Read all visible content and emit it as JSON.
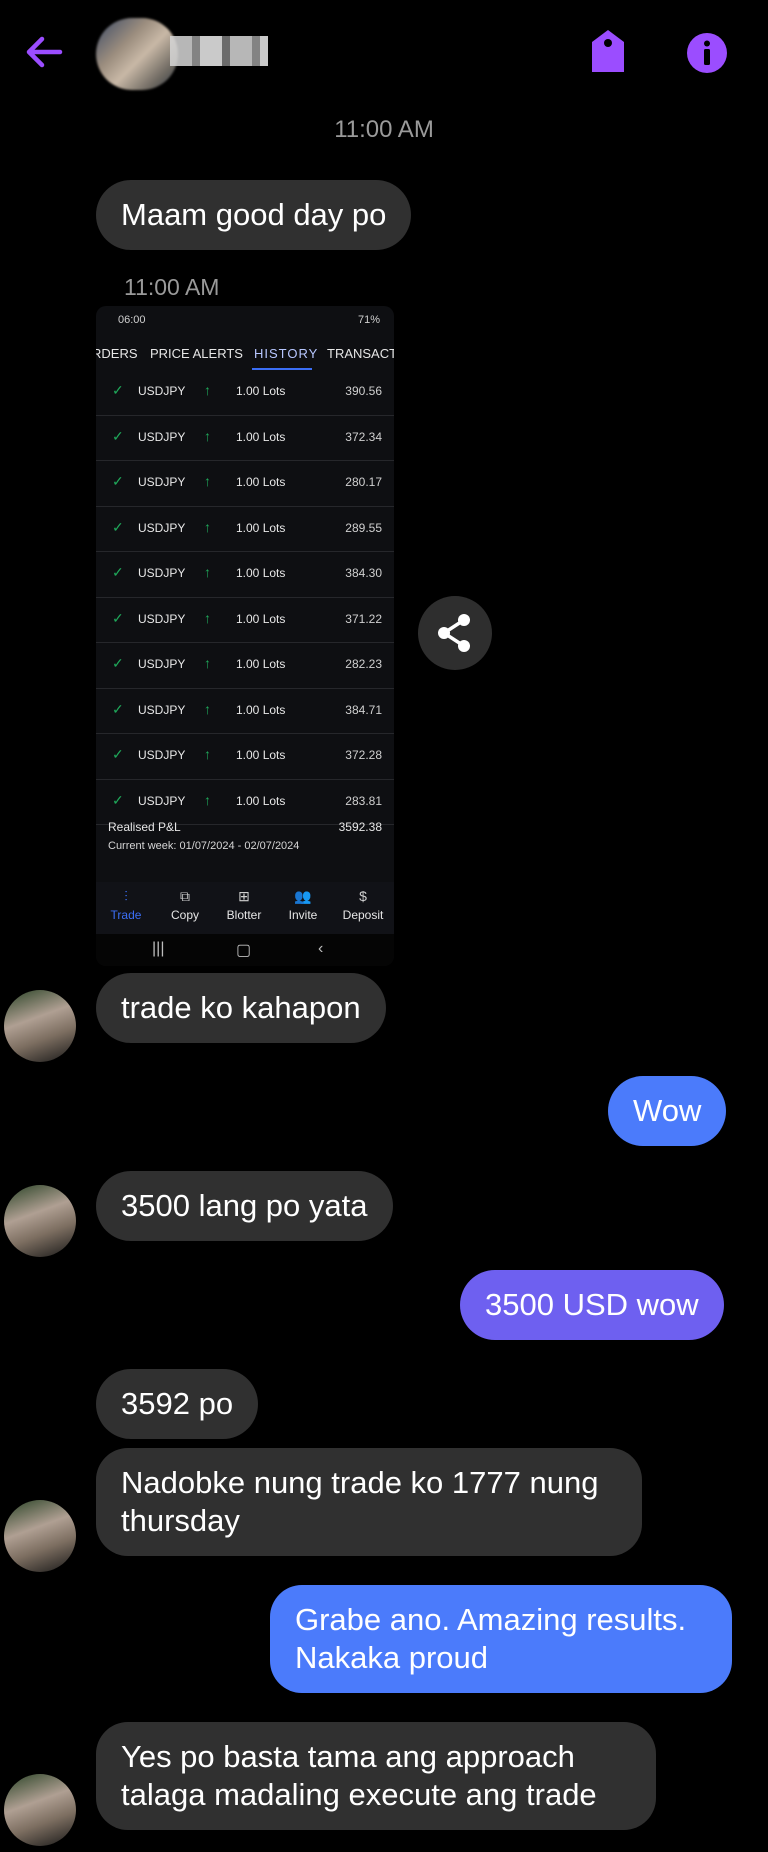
{
  "header": {
    "back_icon": "arrow-left-icon",
    "tag_icon": "tag-icon",
    "info_icon": "info-icon",
    "accent_color": "#9b4dff"
  },
  "messages": {
    "timestamp_1": "11:00 AM",
    "msg_1": "Maam good day po",
    "timestamp_2": "11:00 AM",
    "msg_2": "trade ko kahapon",
    "msg_3": "Wow",
    "msg_4": "3500 lang po yata",
    "msg_5": "3500 USD wow",
    "msg_6": "3592 po",
    "msg_7": "Nadobke nung trade ko 1777 nung\nthursday",
    "msg_8": "Grabe ano. Amazing results.\nNakaka proud",
    "msg_9": "Yes po basta tama ang approach\ntalaga madaling execute ang trade"
  },
  "screenshot": {
    "status_time": "06:00",
    "status_right": "71%",
    "tabs": [
      "RDERS",
      "PRICE ALERTS",
      "HISTORY",
      "TRANSACT"
    ],
    "rows": [
      {
        "symbol": "USDJPY",
        "lots": "1.00 Lots",
        "pnl": "390.56"
      },
      {
        "symbol": "USDJPY",
        "lots": "1.00 Lots",
        "pnl": "372.34"
      },
      {
        "symbol": "USDJPY",
        "lots": "1.00 Lots",
        "pnl": "280.17"
      },
      {
        "symbol": "USDJPY",
        "lots": "1.00 Lots",
        "pnl": "289.55"
      },
      {
        "symbol": "USDJPY",
        "lots": "1.00 Lots",
        "pnl": "384.30"
      },
      {
        "symbol": "USDJPY",
        "lots": "1.00 Lots",
        "pnl": "371.22"
      },
      {
        "symbol": "USDJPY",
        "lots": "1.00 Lots",
        "pnl": "282.23"
      },
      {
        "symbol": "USDJPY",
        "lots": "1.00 Lots",
        "pnl": "384.71"
      },
      {
        "symbol": "USDJPY",
        "lots": "1.00 Lots",
        "pnl": "372.28"
      },
      {
        "symbol": "USDJPY",
        "lots": "1.00 Lots",
        "pnl": "283.81"
      }
    ],
    "realised_label": "Realised P&L",
    "realised_value": "3592.38",
    "week_label": "Current week: 01/07/2024 - 02/07/2024",
    "nav": [
      "Trade",
      "Copy",
      "Blotter",
      "Invite",
      "Deposit"
    ]
  },
  "share_icon": "share-icon"
}
